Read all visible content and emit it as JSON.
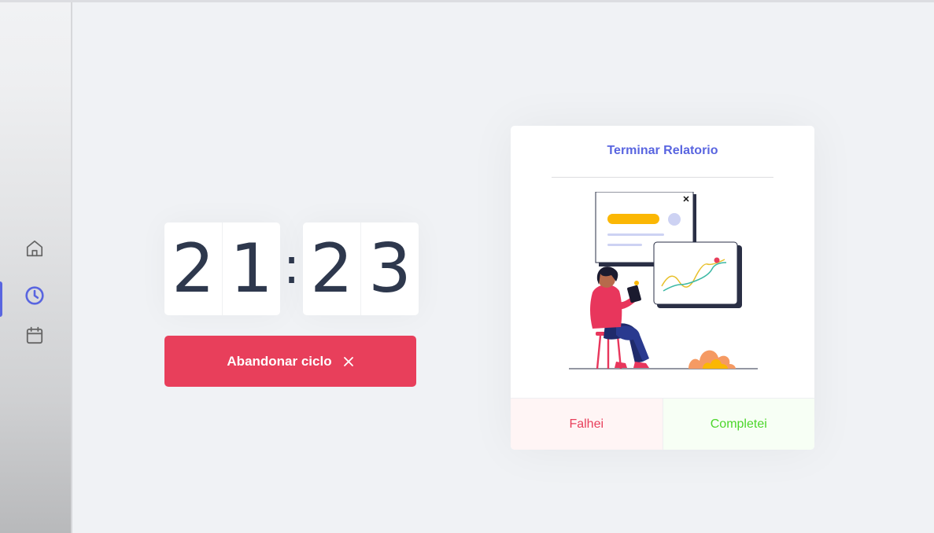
{
  "sidebar": {
    "items": [
      {
        "icon": "home-icon"
      },
      {
        "icon": "clock-icon",
        "active": true
      },
      {
        "icon": "calendar-icon"
      }
    ],
    "accent_color": "#5965e0"
  },
  "timer": {
    "minutes": [
      "2",
      "1"
    ],
    "separator": ":",
    "seconds": [
      "2",
      "3"
    ]
  },
  "abandon_button": {
    "label": "Abandonar ciclo",
    "icon": "close-icon",
    "color": "#e83f5b"
  },
  "task_card": {
    "title": "Terminar Relatorio",
    "illustration": "woman-reading-report-illustration",
    "fail_label": "Falhei",
    "complete_label": "Completei",
    "fail_color": "#e83f5b",
    "complete_color": "#4cd62b"
  }
}
